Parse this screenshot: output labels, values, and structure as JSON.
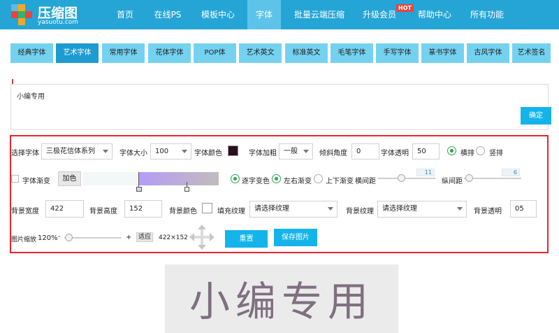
{
  "header": {
    "brand": "压缩图",
    "domain": "yasuotu.com",
    "nav": [
      "首页",
      "在线PS",
      "模板中心",
      "字体",
      "批量云端压缩",
      "升级会员",
      "帮助中心",
      "所有功能"
    ],
    "active_nav": "字体",
    "hot_badge": "HOT"
  },
  "tabs": [
    "经典字体",
    "艺术字体",
    "常用字体",
    "花体字体",
    "POP体",
    "艺术英文",
    "标准英文",
    "毛笔字体",
    "手写字体",
    "篆书字体",
    "古风字体",
    "艺术签名"
  ],
  "active_tab": "艺术字体",
  "text_input": {
    "value": "小编专用",
    "confirm_label": "确定"
  },
  "controls": {
    "font_label": "选择字体",
    "font_value": "三极花信体系列",
    "size_label": "字体大小",
    "size_value": "100",
    "color_label": "字体颜色",
    "color_value": "#2a0e1d",
    "bold_label": "字体加粗",
    "bold_value": "一般",
    "skew_label": "倾斜角度",
    "skew_value": "0",
    "opacity_label": "字体透明",
    "opacity_value": "50",
    "horizontal_label": "横排",
    "vertical_label": "竖排",
    "gradient_label": "字体渐变",
    "add_color_label": "加色",
    "gradient_colors": [
      "#f3f7f8",
      "#b49cf8",
      "#c2bcbc"
    ],
    "per_char_label": "逐字变色",
    "lr_gradient_label": "左右渐变",
    "tb_gradient_label": "上下渐变",
    "hspacing_label": "横间距",
    "hspacing_value": "11",
    "vspacing_label": "纵间距",
    "vspacing_value": "6",
    "bg_width_label": "背景宽度",
    "bg_width_value": "422",
    "bg_height_label": "背景高度",
    "bg_height_value": "152",
    "bg_color_label": "背景颜色",
    "fill_texture_label": "填充纹理",
    "fill_texture_value": "请选择纹理",
    "bg_texture_label": "背景纹理",
    "bg_texture_value": "请选择纹理",
    "bg_opacity_label": "背景透明",
    "bg_opacity_value": "05",
    "zoom_label": "图片缩放",
    "zoom_value": "120%",
    "minus": "-",
    "plus": "+",
    "fit_label": "适应",
    "dims": "422×152",
    "reset_label": "重置",
    "save_label": "保存图片"
  },
  "preview": {
    "text": "小编专用",
    "color": "#7f7080"
  }
}
